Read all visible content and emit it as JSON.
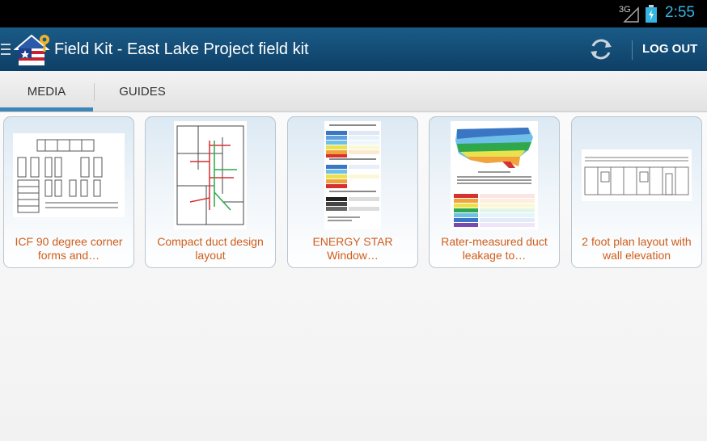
{
  "status_bar": {
    "network": "3G",
    "time": "2:55",
    "battery_icon": "battery-charging-icon",
    "signal_icon": "signal-icon"
  },
  "action_bar": {
    "title": "Field Kit - East Lake Project field kit",
    "logout_label": "LOG OUT",
    "sync_icon": "sync-icon",
    "menu_icon": "menu-icon"
  },
  "tabs": [
    {
      "label": "MEDIA",
      "selected": true
    },
    {
      "label": "GUIDES",
      "selected": false
    }
  ],
  "media": [
    {
      "title": "ICF 90 degree corner forms and…"
    },
    {
      "title": "Compact duct design layout"
    },
    {
      "title": "ENERGY STAR Window…"
    },
    {
      "title": "Rater-measured duct leakage to…"
    },
    {
      "title": "2 foot plan layout with wall elevation"
    }
  ],
  "colors": {
    "action_bar": "#1a5b87",
    "label_orange": "#d05d1a",
    "clock_blue": "#33b5e5"
  }
}
